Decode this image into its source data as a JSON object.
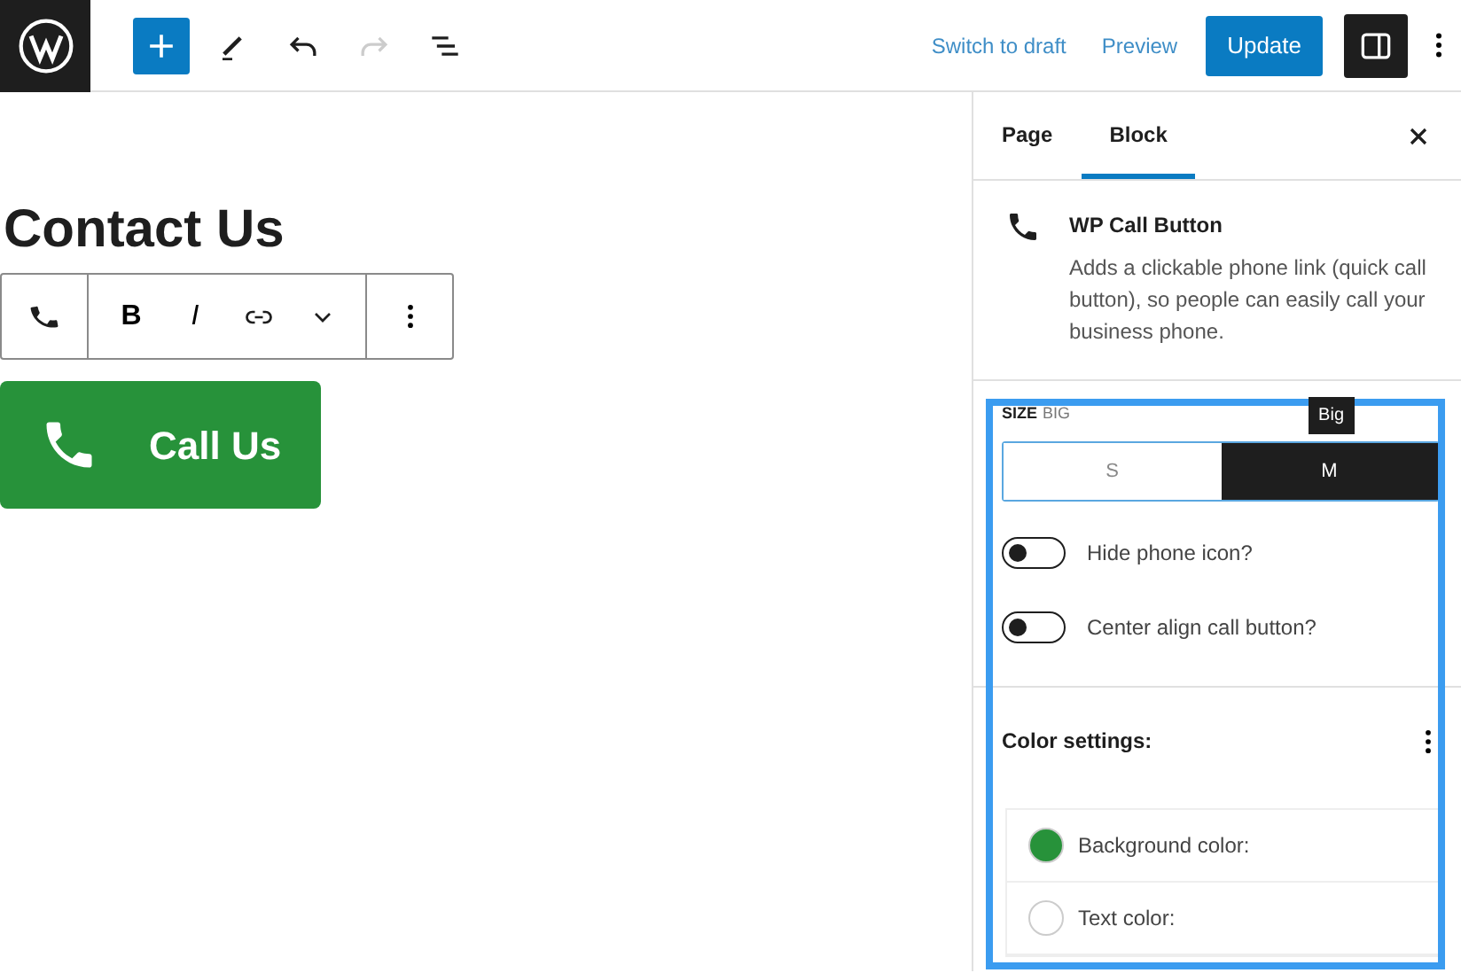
{
  "topbar": {
    "actions": [
      {
        "kind": "add",
        "selected": true
      },
      {
        "kind": "edit",
        "selected": false
      },
      {
        "kind": "undo",
        "selected": false
      },
      {
        "kind": "redo",
        "selected": false
      },
      {
        "kind": "outline",
        "selected": false
      }
    ],
    "switch_to_draft": "Switch to draft",
    "preview": "Preview",
    "update": "Update",
    "settings_selected": true
  },
  "canvas": {
    "heading": "Contact Us",
    "toolbar": {
      "tools": [
        {
          "kind": "phone"
        },
        {
          "kind": "bold",
          "label": "B"
        },
        {
          "kind": "italic",
          "label": "I"
        },
        {
          "kind": "link"
        },
        {
          "kind": "more"
        },
        {
          "kind": "options"
        }
      ]
    },
    "call_button": {
      "label": "Call Us",
      "color": "#27923a"
    }
  },
  "sidebar": {
    "tabs": [
      {
        "label": "Page",
        "selected": false
      },
      {
        "label": "Block",
        "selected": true
      }
    ],
    "block": {
      "title": "WP Call Button",
      "description": "Adds a clickable phone link (quick call button), so people can easily call your business phone."
    },
    "size": {
      "label": "SIZE",
      "value": "BIG",
      "tooltip": "Big",
      "options": [
        {
          "label": "S",
          "selected": false
        },
        {
          "label": "M",
          "selected": true
        }
      ]
    },
    "toggles": [
      {
        "label": "Hide phone icon?",
        "on": false
      },
      {
        "label": "Center align call button?",
        "on": false
      }
    ],
    "color_settings": {
      "title": "Color settings:",
      "items": [
        {
          "label": "Background color:",
          "color": "#27923a"
        },
        {
          "label": "Text color:",
          "color": "#ffffff"
        }
      ]
    }
  }
}
